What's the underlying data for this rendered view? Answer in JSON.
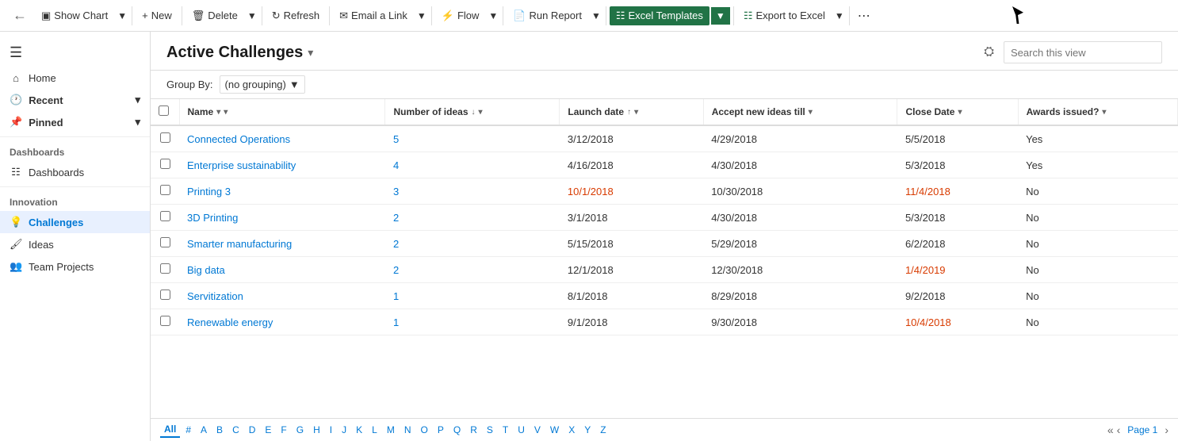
{
  "toolbar": {
    "back_label": "←",
    "show_chart_label": "Show Chart",
    "new_label": "New",
    "delete_label": "Delete",
    "refresh_label": "Refresh",
    "email_link_label": "Email a Link",
    "flow_label": "Flow",
    "run_report_label": "Run Report",
    "excel_templates_label": "Excel Templates",
    "export_excel_label": "Export to Excel",
    "more_label": "⋯"
  },
  "sidebar": {
    "hamburger": "☰",
    "section_home": "Home",
    "section_recent": "Recent",
    "section_recent_chevron": "▾",
    "section_pinned": "Pinned",
    "section_pinned_chevron": "▾",
    "dashboards_section": "Dashboards",
    "dashboards_item": "Dashboards",
    "innovation_section": "Innovation",
    "challenges_item": "Challenges",
    "ideas_item": "Ideas",
    "team_projects_item": "Team Projects"
  },
  "page": {
    "title": "Active Challenges",
    "title_chevron": "▾",
    "search_placeholder": "Search this view",
    "groupby_label": "Group By:",
    "groupby_value": "(no grouping)"
  },
  "columns": [
    {
      "id": "checkbox",
      "label": ""
    },
    {
      "id": "name",
      "label": "Name",
      "sort": "▾",
      "has_chevron": true
    },
    {
      "id": "ideas",
      "label": "Number of ideas",
      "sort": "↓",
      "has_chevron": true
    },
    {
      "id": "launch",
      "label": "Launch date",
      "sort": "↑",
      "has_chevron": true
    },
    {
      "id": "accept",
      "label": "Accept new ideas till",
      "sort": "▾",
      "has_chevron": false
    },
    {
      "id": "close",
      "label": "Close Date",
      "sort": "▾",
      "has_chevron": false
    },
    {
      "id": "awards",
      "label": "Awards issued?",
      "sort": "▾",
      "has_chevron": false
    }
  ],
  "rows": [
    {
      "name": "Connected Operations",
      "ideas": "5",
      "launch": "3/12/2018",
      "accept": "4/29/2018",
      "close": "5/5/2018",
      "awards": "Yes",
      "launch_red": false,
      "close_red": false
    },
    {
      "name": "Enterprise sustainability",
      "ideas": "4",
      "launch": "4/16/2018",
      "accept": "4/30/2018",
      "close": "5/3/2018",
      "awards": "Yes",
      "launch_red": false,
      "close_red": false
    },
    {
      "name": "Printing 3",
      "ideas": "3",
      "launch": "10/1/2018",
      "accept": "10/30/2018",
      "close": "11/4/2018",
      "awards": "No",
      "launch_red": true,
      "close_red": true
    },
    {
      "name": "3D Printing",
      "ideas": "2",
      "launch": "3/1/2018",
      "accept": "4/30/2018",
      "close": "5/3/2018",
      "awards": "No",
      "launch_red": false,
      "close_red": false
    },
    {
      "name": "Smarter manufacturing",
      "ideas": "2",
      "launch": "5/15/2018",
      "accept": "5/29/2018",
      "close": "6/2/2018",
      "awards": "No",
      "launch_red": false,
      "close_red": false
    },
    {
      "name": "Big data",
      "ideas": "2",
      "launch": "12/1/2018",
      "accept": "12/30/2018",
      "close": "1/4/2019",
      "awards": "No",
      "launch_red": false,
      "close_red": true
    },
    {
      "name": "Servitization",
      "ideas": "1",
      "launch": "8/1/2018",
      "accept": "8/29/2018",
      "close": "9/2/2018",
      "awards": "No",
      "launch_red": false,
      "close_red": false
    },
    {
      "name": "Renewable energy",
      "ideas": "1",
      "launch": "9/1/2018",
      "accept": "9/30/2018",
      "close": "10/4/2018",
      "awards": "No",
      "launch_red": false,
      "close_red": true
    }
  ],
  "alpha": [
    "All",
    "#",
    "A",
    "B",
    "C",
    "D",
    "E",
    "F",
    "G",
    "H",
    "I",
    "J",
    "K",
    "L",
    "M",
    "N",
    "O",
    "P",
    "Q",
    "R",
    "S",
    "T",
    "U",
    "V",
    "W",
    "X",
    "Y",
    "Z"
  ],
  "pagination": {
    "page_label": "Page 1",
    "prev": "‹",
    "first": "«",
    "next": "›"
  },
  "colors": {
    "accent_blue": "#0078d4",
    "excel_green": "#217346",
    "red_date": "#d83b01"
  }
}
